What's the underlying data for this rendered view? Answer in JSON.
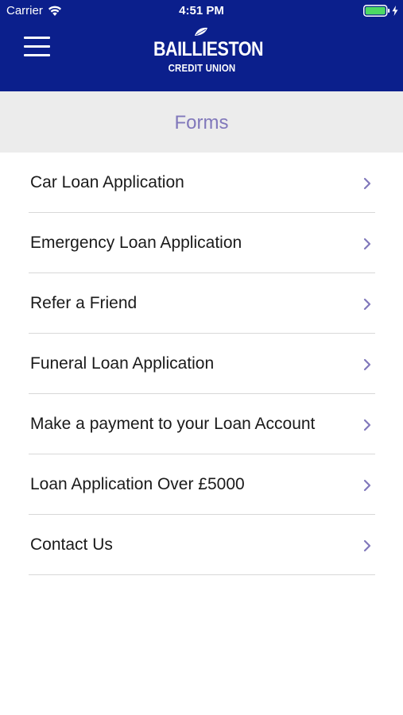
{
  "status_bar": {
    "carrier": "Carrier",
    "time": "4:51 PM",
    "battery_color": "#4cd964"
  },
  "header": {
    "background_color": "#0b1f8c",
    "menu_icon": "hamburger-menu-icon",
    "logo": {
      "name": "BAILLIESTON",
      "subtitle": "CREDIT UNION"
    }
  },
  "page": {
    "title": "Forms",
    "title_color": "#8178bb"
  },
  "forms_list": {
    "chevron_color": "#8178bb",
    "items": [
      {
        "label": "Car Loan Application"
      },
      {
        "label": "Emergency Loan Application"
      },
      {
        "label": "Refer a Friend"
      },
      {
        "label": "Funeral Loan Application"
      },
      {
        "label": "Make a payment to your Loan Account"
      },
      {
        "label": "Loan Application Over £5000"
      },
      {
        "label": "Contact Us"
      }
    ]
  }
}
